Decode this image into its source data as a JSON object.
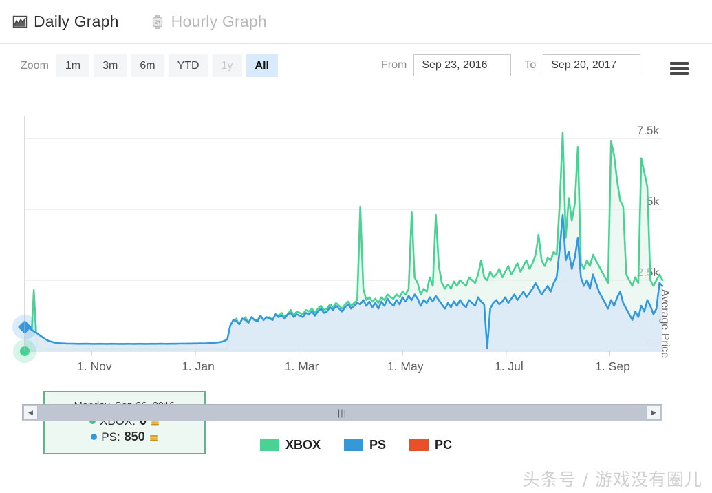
{
  "tabs": [
    {
      "label": "Daily Graph",
      "icon": "line-chart-icon",
      "active": true
    },
    {
      "label": "Hourly Graph",
      "icon": "watch-24h-icon",
      "active": false
    }
  ],
  "toolbar": {
    "zoom_label": "Zoom",
    "zoom_buttons": [
      {
        "label": "1m",
        "state": "normal"
      },
      {
        "label": "3m",
        "state": "normal"
      },
      {
        "label": "6m",
        "state": "normal"
      },
      {
        "label": "YTD",
        "state": "normal"
      },
      {
        "label": "1y",
        "state": "disabled"
      },
      {
        "label": "All",
        "state": "selected"
      }
    ],
    "from_label": "From",
    "from_value": "Sep 23, 2016",
    "to_label": "To",
    "to_value": "Sep 20, 2017",
    "menu_icon": "hamburger-menu-icon"
  },
  "tooltip": {
    "date": "Monday, Sep 26, 2016",
    "rows": [
      {
        "series": "XBOX",
        "label": "XBOX:",
        "value": "0",
        "color": "#44c28c",
        "unit_icon": "gold-coin-stack-icon"
      },
      {
        "series": "PS",
        "label": "PS:",
        "value": "850",
        "color": "#3498db",
        "unit_icon": "gold-coin-stack-icon"
      }
    ]
  },
  "scrollbar": {
    "left_arrow": "◀",
    "right_arrow": "▶",
    "grip": "|||"
  },
  "legend": {
    "position": "bottom-center",
    "items": [
      {
        "label": "XBOX",
        "color": "#4ad295"
      },
      {
        "label": "PS",
        "color": "#3498db"
      },
      {
        "label": "PC",
        "color": "#e8502a"
      }
    ]
  },
  "watermark": "头条号 / 游戏没有圈儿",
  "chart_data": {
    "type": "line",
    "title": "",
    "xlabel": "",
    "ylabel": "Average Price",
    "ylim": [
      0,
      8300
    ],
    "yticks": [
      0,
      2500,
      5000,
      7500
    ],
    "ytick_labels": [
      "0k",
      "2.5k",
      "5k",
      "7.5k"
    ],
    "xlim": [
      "Sep 23, 2016",
      "Sep 20, 2017"
    ],
    "xtick_labels": [
      "1. Nov",
      "1. Jan",
      "1. Mar",
      "1. May",
      "1. Jul",
      "1. Sep"
    ],
    "grid": "horizontal",
    "legend_position": "bottom-center",
    "area_fill": true,
    "series": [
      {
        "name": "XBOX",
        "color": "#4ad295",
        "values": [
          120,
          90,
          60,
          2150,
          140,
          110,
          95,
          80,
          70,
          75,
          85,
          80,
          70,
          65,
          70,
          80,
          75,
          70,
          65,
          70,
          80,
          75,
          70,
          72,
          68,
          70,
          75,
          70,
          68,
          72,
          70,
          68,
          70,
          72,
          75,
          70,
          68,
          70,
          72,
          70,
          70,
          72,
          70,
          68,
          70,
          72,
          70,
          70,
          72,
          70,
          68,
          70,
          70,
          72,
          70,
          68,
          70,
          70,
          72,
          70,
          70,
          70,
          72,
          70,
          70,
          72,
          70,
          70,
          700,
          950,
          1150,
          900,
          1050,
          1200,
          1000,
          1150,
          1050,
          1100,
          1250,
          1050,
          1150,
          1200,
          1100,
          1300,
          1250,
          1350,
          1200,
          1300,
          1450,
          1250,
          1400,
          1350,
          1300,
          1450,
          1400,
          1500,
          1350,
          1500,
          1600,
          1450,
          1500,
          1650,
          1550,
          1700,
          1600,
          1500,
          1650,
          1750,
          1600,
          1700,
          1800,
          5100,
          2200,
          1800,
          1900,
          1750,
          1850,
          1700,
          1900,
          1800,
          2000,
          1900,
          1850,
          2000,
          1900,
          2100,
          2000,
          2200,
          4900,
          2600,
          2400,
          2000,
          2200,
          2100,
          2600,
          2300,
          4800,
          3000,
          2400,
          2200,
          2350,
          2200,
          2450,
          2300,
          2500,
          2400,
          2300,
          2600,
          2500,
          2400,
          2700,
          3200,
          2600,
          2500,
          2800,
          2600,
          2700,
          2900,
          2600,
          2800,
          3000,
          2700,
          2900,
          3100,
          2800,
          3000,
          3200,
          2900,
          3100,
          3400,
          4100,
          3200,
          3000,
          3300,
          3200,
          3500,
          3400,
          5200,
          7700,
          4000,
          5400,
          4600,
          5200,
          7200,
          3100,
          2900,
          3200,
          3000,
          3400,
          3200,
          3000,
          2800,
          2600,
          2400,
          7400,
          6900,
          6000,
          5300,
          5100,
          2700,
          2500,
          2300,
          2600,
          2400,
          6800,
          6300,
          5800,
          2500,
          2300,
          2500,
          2700,
          2500
        ]
      },
      {
        "name": "PS",
        "color": "#3498db",
        "values": [
          850,
          920,
          780,
          700,
          640,
          560,
          480,
          410,
          360,
          330,
          300,
          290,
          280,
          275,
          270,
          268,
          265,
          262,
          260,
          262,
          265,
          262,
          260,
          258,
          260,
          262,
          260,
          258,
          260,
          262,
          260,
          258,
          260,
          258,
          262,
          260,
          258,
          260,
          262,
          260,
          258,
          260,
          262,
          260,
          262,
          265,
          262,
          260,
          262,
          265,
          262,
          268,
          270,
          268,
          272,
          270,
          275,
          272,
          278,
          275,
          280,
          285,
          290,
          300,
          310,
          330,
          360,
          420,
          900,
          1100,
          1050,
          950,
          1150,
          1100,
          1000,
          1200,
          1100,
          1050,
          1250,
          1100,
          1200,
          1150,
          1100,
          1300,
          1200,
          1250,
          1150,
          1300,
          1350,
          1200,
          1300,
          1250,
          1200,
          1350,
          1300,
          1400,
          1250,
          1400,
          1500,
          1350,
          1400,
          1550,
          1450,
          1600,
          1500,
          1400,
          1550,
          1650,
          1500,
          1600,
          1700,
          1650,
          1800,
          1600,
          1750,
          1550,
          1700,
          1500,
          1750,
          1600,
          1850,
          1700,
          1600,
          1800,
          1650,
          1900,
          1750,
          1950,
          1800,
          2000,
          1850,
          1600,
          1800,
          1700,
          1900,
          1750,
          1950,
          1800,
          1650,
          1500,
          1700,
          1550,
          1750,
          1600,
          1800,
          1650,
          1550,
          1800,
          1700,
          1600,
          1900,
          1750,
          1650,
          100,
          1500,
          1700,
          1800,
          1650,
          1750,
          1900,
          1700,
          1850,
          2000,
          1800,
          1950,
          2100,
          1900,
          2050,
          2200,
          2400,
          2200,
          2000,
          2150,
          2300,
          2100,
          2400,
          2600,
          3600,
          4800,
          3200,
          3500,
          2900,
          3300,
          4000,
          2600,
          2300,
          2500,
          2200,
          2700,
          2400,
          2100,
          1900,
          1700,
          1500,
          1800,
          1600,
          1900,
          2100,
          1700,
          1500,
          1300,
          1100,
          1400,
          1200,
          1600,
          1400,
          1800,
          1600,
          1300,
          1500,
          2400,
          2300
        ]
      },
      {
        "name": "PC",
        "color": "#e8502a",
        "values": []
      }
    ],
    "highlight": {
      "date": "Monday, Sep 26, 2016",
      "xbox_value": 0,
      "ps_value": 850
    }
  }
}
